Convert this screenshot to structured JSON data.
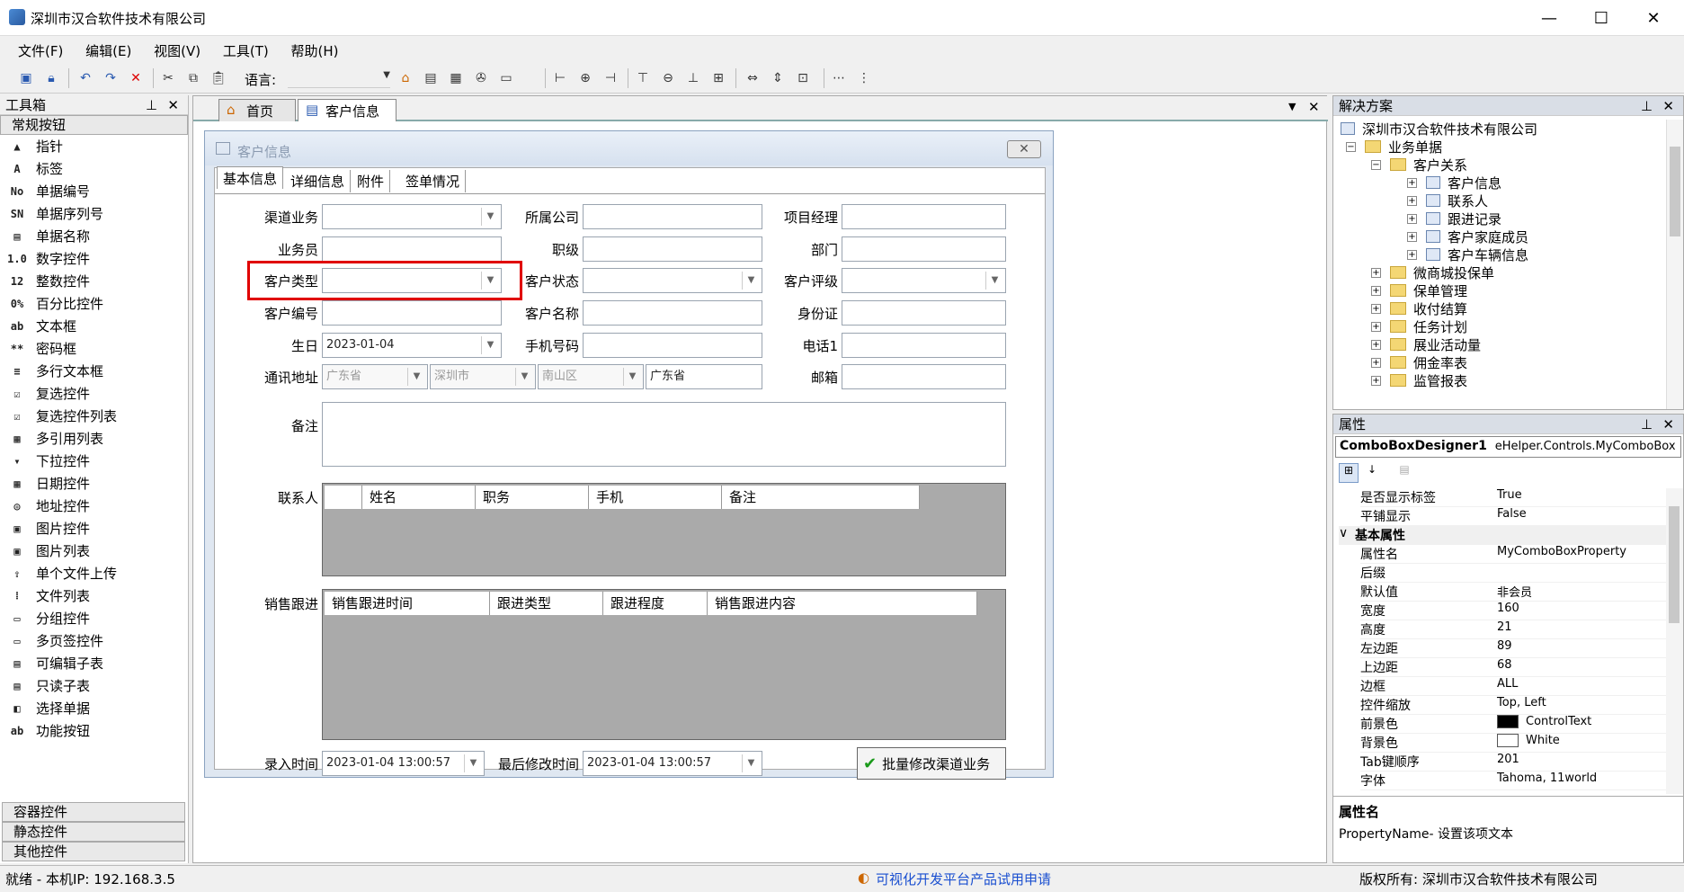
{
  "window": {
    "title": "深圳市汉合软件技术有限公司",
    "minimize": "—",
    "maximize": "☐",
    "close": "✕"
  },
  "menu": [
    "文件(F)",
    "编辑(E)",
    "视图(V)",
    "工具(T)",
    "帮助(H)"
  ],
  "toolbar": {
    "lang_label": "语言:"
  },
  "toolbox": {
    "title": "工具箱",
    "groups": {
      "common": "常规按钮",
      "container": "容器控件",
      "static": "静态控件",
      "other": "其他控件"
    },
    "items": [
      {
        "label": "指针",
        "icon": "▲"
      },
      {
        "label": "标签",
        "icon": "A"
      },
      {
        "label": "单据编号",
        "icon": "No"
      },
      {
        "label": "单据序列号",
        "icon": "SN"
      },
      {
        "label": "单据名称",
        "icon": "▤"
      },
      {
        "label": "数字控件",
        "icon": "1.0"
      },
      {
        "label": "整数控件",
        "icon": "12"
      },
      {
        "label": "百分比控件",
        "icon": "0%"
      },
      {
        "label": "文本框",
        "icon": "ab"
      },
      {
        "label": "密码框",
        "icon": "**"
      },
      {
        "label": "多行文本框",
        "icon": "≡"
      },
      {
        "label": "复选控件",
        "icon": "☑"
      },
      {
        "label": "复选控件列表",
        "icon": "☑"
      },
      {
        "label": "多引用列表",
        "icon": "▦"
      },
      {
        "label": "下拉控件",
        "icon": "▾"
      },
      {
        "label": "日期控件",
        "icon": "▦"
      },
      {
        "label": "地址控件",
        "icon": "◎"
      },
      {
        "label": "图片控件",
        "icon": "▣"
      },
      {
        "label": "图片列表",
        "icon": "▣"
      },
      {
        "label": "单个文件上传",
        "icon": "⇪"
      },
      {
        "label": "文件列表",
        "icon": "⁞"
      },
      {
        "label": "分组控件",
        "icon": "▭"
      },
      {
        "label": "多页签控件",
        "icon": "▭"
      },
      {
        "label": "可编辑子表",
        "icon": "▤"
      },
      {
        "label": "只读子表",
        "icon": "▤"
      },
      {
        "label": "选择单据",
        "icon": "◧"
      },
      {
        "label": "功能按钮",
        "icon": "ab"
      }
    ]
  },
  "tabs": {
    "home": "首页",
    "customer": "客户信息"
  },
  "form": {
    "title": "客户信息",
    "close": "✕",
    "tabs": [
      "基本信息",
      "详细信息",
      "附件",
      "签单情况"
    ],
    "labels": {
      "channel": "渠道业务",
      "company": "所属公司",
      "pm": "项目经理",
      "salesman": "业务员",
      "rank": "职级",
      "dept": "部门",
      "ctype": "客户类型",
      "cstatus": "客户状态",
      "crating": "客户评级",
      "cno": "客户编号",
      "cname": "客户名称",
      "idcard": "身份证",
      "birthday": "生日",
      "mobile": "手机号码",
      "phone1": "电话1",
      "address": "通讯地址",
      "email": "邮箱",
      "remark": "备注",
      "contacts": "联系人",
      "followup": "销售跟进",
      "entrytime": "录入时间",
      "modtime": "最后修改时间"
    },
    "values": {
      "birthday": "2023-01-04",
      "province": "广东省",
      "city": "深圳市",
      "district": "南山区",
      "addr_detail": "广东省",
      "entrytime": "2023-01-04 13:00:57",
      "modtime": "2023-01-04 13:00:57"
    },
    "contacts_cols": [
      "姓名",
      "职务",
      "手机",
      "备注"
    ],
    "followup_cols": [
      "销售跟进时间",
      "跟进类型",
      "跟进程度",
      "销售跟进内容"
    ],
    "batch_button": "批量修改渠道业务"
  },
  "solution": {
    "title": "解决方案",
    "root": "深圳市汉合软件技术有限公司",
    "biz": "业务单据",
    "crm": "客户关系",
    "leaves": [
      "客户信息",
      "联系人",
      "跟进记录",
      "客户家庭成员",
      "客户车辆信息"
    ],
    "folders": [
      "微商城投保单",
      "保单管理",
      "收付结算",
      "任务计划",
      "展业活动量",
      "佣金率表",
      "监管报表"
    ]
  },
  "properties": {
    "title": "属性",
    "selected_name": "ComboBoxDesigner1",
    "selected_type": "eHelper.Controls.MyComboBox",
    "rows": [
      {
        "k": "是否显示标签",
        "v": "True"
      },
      {
        "k": "平铺显示",
        "v": "False"
      },
      {
        "k": "基本属性",
        "v": ""
      },
      {
        "k": "属性名",
        "v": "MyComboBoxProperty"
      },
      {
        "k": "后缀",
        "v": ""
      },
      {
        "k": "默认值",
        "v": "非会员"
      },
      {
        "k": "宽度",
        "v": "160"
      },
      {
        "k": "高度",
        "v": "21"
      },
      {
        "k": "左边距",
        "v": "89"
      },
      {
        "k": "上边距",
        "v": "68"
      },
      {
        "k": "边框",
        "v": "ALL"
      },
      {
        "k": "控件缩放",
        "v": "Top, Left"
      },
      {
        "k": "前景色",
        "v": "ControlText"
      },
      {
        "k": "背景色",
        "v": "White"
      },
      {
        "k": "Tab键顺序",
        "v": "201"
      },
      {
        "k": "字体",
        "v": "Tahoma, 11world"
      }
    ],
    "desc_title": "属性名",
    "desc_text": "PropertyName- 设置该项文本"
  },
  "status": {
    "left": "就绪 - 本机IP: 192.168.3.5",
    "middle": "可视化开发平台产品试用申请",
    "right": "版权所有: 深圳市汉合软件技术有限公司"
  },
  "colors": {
    "accent": "#e00000",
    "link": "#1a4fd0"
  }
}
